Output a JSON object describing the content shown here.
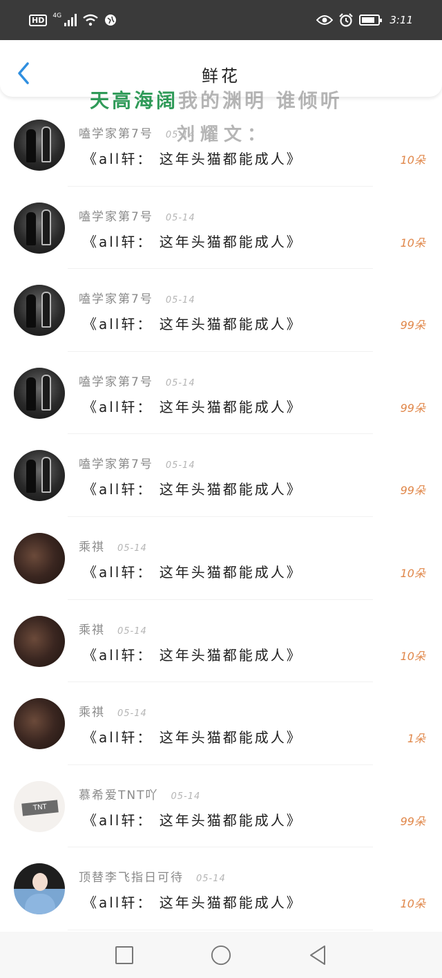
{
  "status_bar": {
    "hd": "HD",
    "network": "4G",
    "time": "3:11",
    "icons": [
      "signal-icon",
      "wifi-icon",
      "vpn-icon",
      "eye-icon",
      "alarm-icon",
      "battery-icon"
    ]
  },
  "header": {
    "title": "鲜花",
    "back_icon": "chevron-left-icon"
  },
  "watermark": {
    "green": "天高海阔",
    "gray": "我的渊明 谁倾听",
    "line2": "刘耀文："
  },
  "colors": {
    "accent_blue": "#2f8fe0",
    "count_orange": "#e0874a",
    "watermark_green": "#2f9a58"
  },
  "items": [
    {
      "name": "嗑学家第7号",
      "date": "05-14",
      "book": "《all轩： 这年头猫都能成人》",
      "count": "10朵",
      "avatar": "dark"
    },
    {
      "name": "嗑学家第7号",
      "date": "05-14",
      "book": "《all轩： 这年头猫都能成人》",
      "count": "10朵",
      "avatar": "dark"
    },
    {
      "name": "嗑学家第7号",
      "date": "05-14",
      "book": "《all轩： 这年头猫都能成人》",
      "count": "99朵",
      "avatar": "dark"
    },
    {
      "name": "嗑学家第7号",
      "date": "05-14",
      "book": "《all轩： 这年头猫都能成人》",
      "count": "99朵",
      "avatar": "dark"
    },
    {
      "name": "嗑学家第7号",
      "date": "05-14",
      "book": "《all轩： 这年头猫都能成人》",
      "count": "99朵",
      "avatar": "dark"
    },
    {
      "name": "乘祺",
      "date": "05-14",
      "book": "《all轩： 这年头猫都能成人》",
      "count": "10朵",
      "avatar": "brown"
    },
    {
      "name": "乘祺",
      "date": "05-14",
      "book": "《all轩： 这年头猫都能成人》",
      "count": "10朵",
      "avatar": "brown"
    },
    {
      "name": "乘祺",
      "date": "05-14",
      "book": "《all轩： 这年头猫都能成人》",
      "count": "1朵",
      "avatar": "brown"
    },
    {
      "name": "慕希爱TNT吖",
      "date": "05-14",
      "book": "《all轩： 这年头猫都能成人》",
      "count": "99朵",
      "avatar": "tnt"
    },
    {
      "name": "顶替李飞指日可待",
      "date": "05-14",
      "book": "《all轩： 这年头猫都能成人》",
      "count": "10朵",
      "avatar": "girl"
    }
  ],
  "avatar_tnt_text": "TNT",
  "nav": {
    "icons": [
      "recents-square-icon",
      "home-circle-icon",
      "back-triangle-icon"
    ]
  }
}
